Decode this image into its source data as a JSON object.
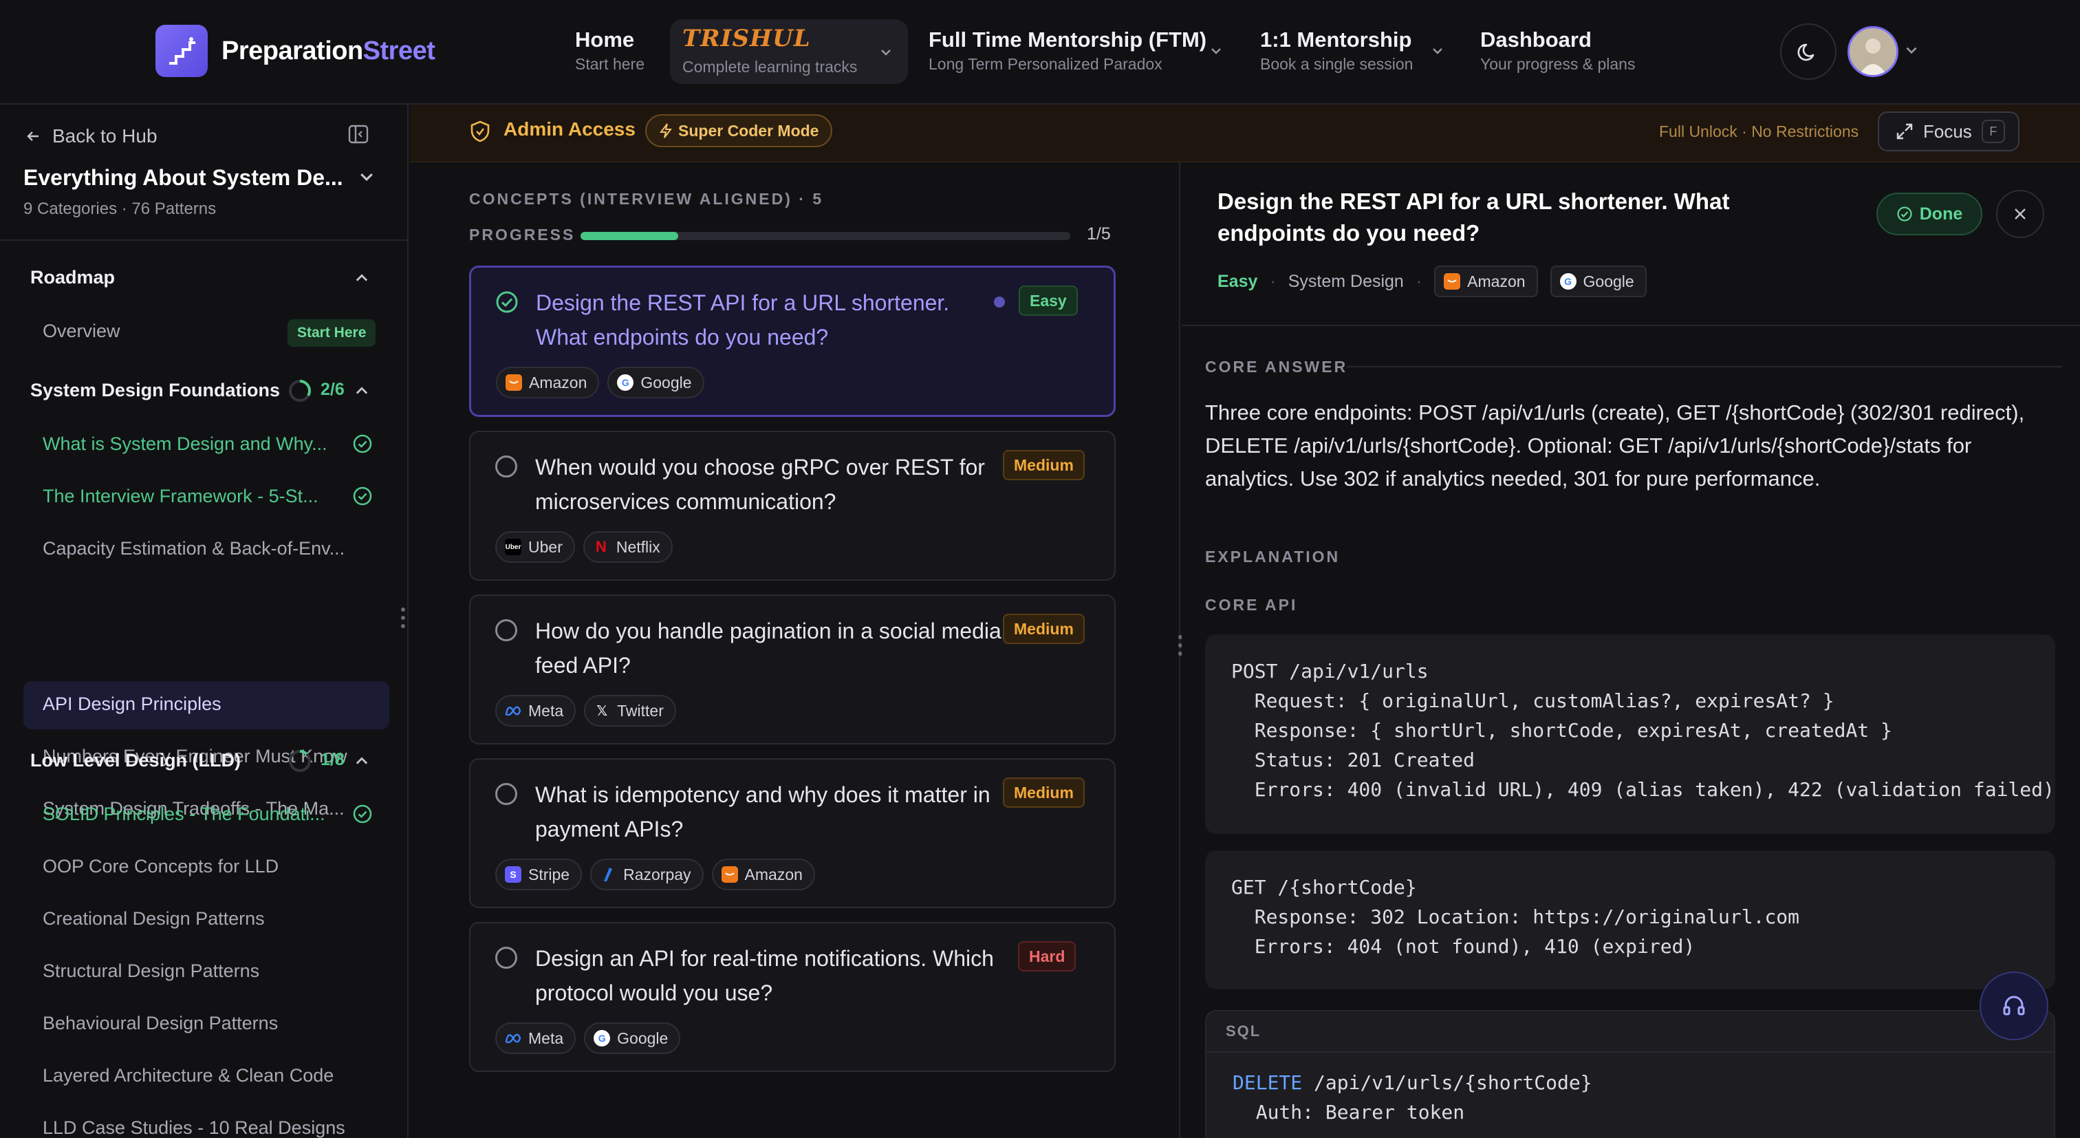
{
  "brand": {
    "name_part1": "Preparation",
    "name_part2": "Street"
  },
  "nav": {
    "home": {
      "title": "Home",
      "sub": "Start here"
    },
    "trishul": {
      "brand": "TRISHUL",
      "sub": "Complete learning tracks"
    },
    "ftm": {
      "title": "Full Time Mentorship (FTM)",
      "sub": "Long Term Personalized Paradox"
    },
    "one_one": {
      "title": "1:1 Mentorship",
      "sub": "Book a single session"
    },
    "dashboard": {
      "title": "Dashboard",
      "sub": "Your progress & plans"
    }
  },
  "sidebar": {
    "back": "Back to Hub",
    "course_title": "Everything About System De...",
    "course_sub": "9 Categories · 76 Patterns",
    "roadmap": "Roadmap",
    "overview": "Overview",
    "start_here": "Start Here",
    "sections": [
      {
        "title": "System Design Foundations",
        "progress": "2/6",
        "progress_fraction": 0.333
      },
      {
        "title": "Low Level Design (LLD)",
        "progress": "1/8",
        "progress_fraction": 0.125
      }
    ],
    "foundations_items": [
      {
        "label": "What is System Design and Why...",
        "done": true
      },
      {
        "label": "The Interview Framework - 5-St...",
        "done": true
      },
      {
        "label": "Capacity Estimation & Back-of-Env...",
        "done": false
      },
      {
        "label": "API Design Principles",
        "done": false,
        "active": true
      },
      {
        "label": "Numbers Every Engineer Must Know",
        "done": false
      },
      {
        "label": "System Design Tradeoffs - The Ma...",
        "done": false
      }
    ],
    "lld_items": [
      {
        "label": "SOLID Principles - The Foundati...",
        "done": true
      },
      {
        "label": "OOP Core Concepts for LLD",
        "done": false
      },
      {
        "label": "Creational Design Patterns",
        "done": false
      },
      {
        "label": "Structural Design Patterns",
        "done": false
      },
      {
        "label": "Behavioural Design Patterns",
        "done": false
      },
      {
        "label": "Layered Architecture & Clean Code",
        "done": false
      },
      {
        "label": "LLD Case Studies - 10 Real Designs",
        "done": false
      }
    ]
  },
  "admin": {
    "label": "Admin Access",
    "badge": "Super Coder Mode",
    "unlock": "Full Unlock · No Restrictions",
    "focus": "Focus",
    "focus_key": "F"
  },
  "concepts": {
    "header": "CONCEPTS (INTERVIEW ALIGNED) · 5",
    "progress_label": "PROGRESS",
    "progress_count": "1/5",
    "progress_fraction": 0.2,
    "questions": [
      {
        "title": "Design the REST API for a URL shortener. What endpoints do you need?",
        "difficulty": "Easy",
        "tags": [
          "Amazon",
          "Google"
        ]
      },
      {
        "title": "When would you choose gRPC over REST for microservices communication?",
        "difficulty": "Medium",
        "tags": [
          "Uber",
          "Netflix"
        ]
      },
      {
        "title": "How do you handle pagination in a social media feed API?",
        "difficulty": "Medium",
        "tags": [
          "Meta",
          "Twitter"
        ]
      },
      {
        "title": "What is idempotency and why does it matter in payment APIs?",
        "difficulty": "Medium",
        "tags": [
          "Stripe",
          "Razorpay",
          "Amazon"
        ]
      },
      {
        "title": "Design an API for real-time notifications. Which protocol would you use?",
        "difficulty": "Hard",
        "tags": [
          "Meta",
          "Google"
        ]
      }
    ]
  },
  "detail": {
    "title": "Design the REST API for a URL shortener. What endpoints do you need?",
    "done": "Done",
    "difficulty": "Easy",
    "topic": "System Design",
    "tags": [
      "Amazon",
      "Google"
    ],
    "core_answer_hdr": "CORE ANSWER",
    "core_answer": "Three core endpoints: POST /api/v1/urls (create), GET /{shortCode} (302/301 redirect), DELETE /api/v1/urls/{shortCode}. Optional: GET /api/v1/urls/{shortCode}/stats for analytics. Use 302 if analytics needed, 301 for pure performance.",
    "explanation_hdr": "EXPLANATION",
    "core_api_hdr": "CORE API",
    "code1": "POST /api/v1/urls\n  Request: { originalUrl, customAlias?, expiresAt? }\n  Response: { shortUrl, shortCode, expiresAt, createdAt }\n  Status: 201 Created\n  Errors: 400 (invalid URL), 409 (alias taken), 422 (validation failed)",
    "code2": "GET /{shortCode}\n  Response: 302 Location: https://originalurl.com\n  Errors: 404 (not found), 410 (expired)",
    "sql_hdr": "SQL",
    "sql_kw": "DELETE",
    "sql_line1_rest": " /api/v1/urls/{shortCode}",
    "sql_line2": "  Auth: Bearer token"
  }
}
